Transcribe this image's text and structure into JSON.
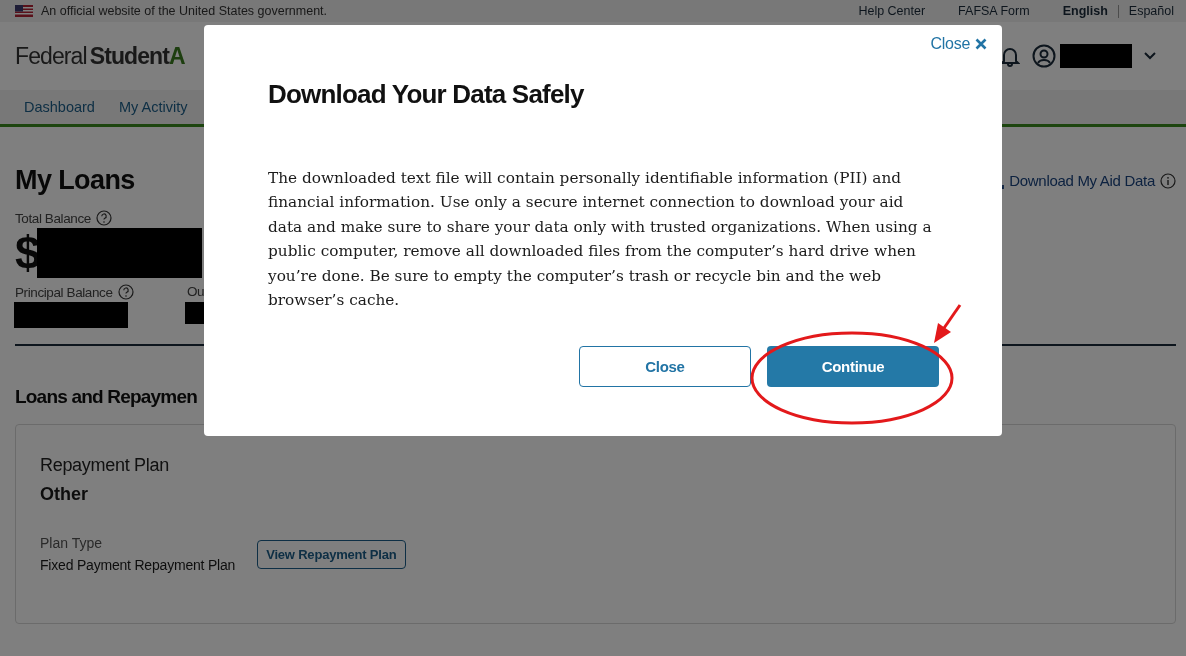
{
  "gov_banner": {
    "text": "An official website of the United States government.",
    "links": [
      "Help Center",
      "FAFSA Form"
    ],
    "languages": [
      {
        "label": "English",
        "selected": true
      },
      {
        "label": "Español",
        "selected": false
      }
    ]
  },
  "header": {
    "logo": {
      "light": "Federal",
      "bold": "Student",
      "accent": "A"
    }
  },
  "nav": {
    "items": [
      {
        "label": "Dashboard"
      },
      {
        "label": "My Activity"
      }
    ]
  },
  "page": {
    "title": "My Loans",
    "download_link": "Download My Aid Data",
    "total_balance": {
      "label": "Total Balance",
      "currency": "$"
    },
    "principal_balance": {
      "label": "Principal Balance"
    },
    "column_2_label": "Ou",
    "section_title": "Loans and Repaymen",
    "card": {
      "heading": "Repayment Plan",
      "value": "Other",
      "plan_type_label": "Plan Type",
      "plan_type_value": "Fixed Payment Repayment Plan",
      "button": "View Repayment Plan"
    }
  },
  "modal": {
    "close_link": "Close",
    "title": "Download Your Data Safely",
    "body": "The downloaded text file will contain personally identifiable information (PII) and financial information. Use only a secure internet connection to download your aid data and make sure to share your data only with trusted organizations. When using a public computer, remove all downloaded files from the computer’s hard drive when you’re done. Be sure to empty the computer’s trash or recycle bin and the web browser’s cache.",
    "buttons": [
      {
        "label": "Close",
        "kind": "secondary"
      },
      {
        "label": "Continue",
        "kind": "primary"
      }
    ]
  }
}
